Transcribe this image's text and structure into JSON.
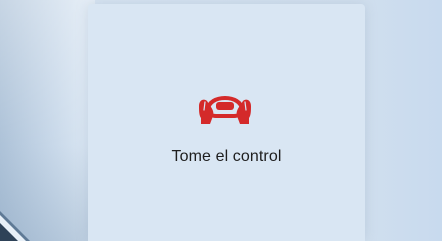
{
  "alert": {
    "icon": "hands-on-wheel-icon",
    "message": "Tome el control",
    "accent_color": "#d42a2a"
  }
}
